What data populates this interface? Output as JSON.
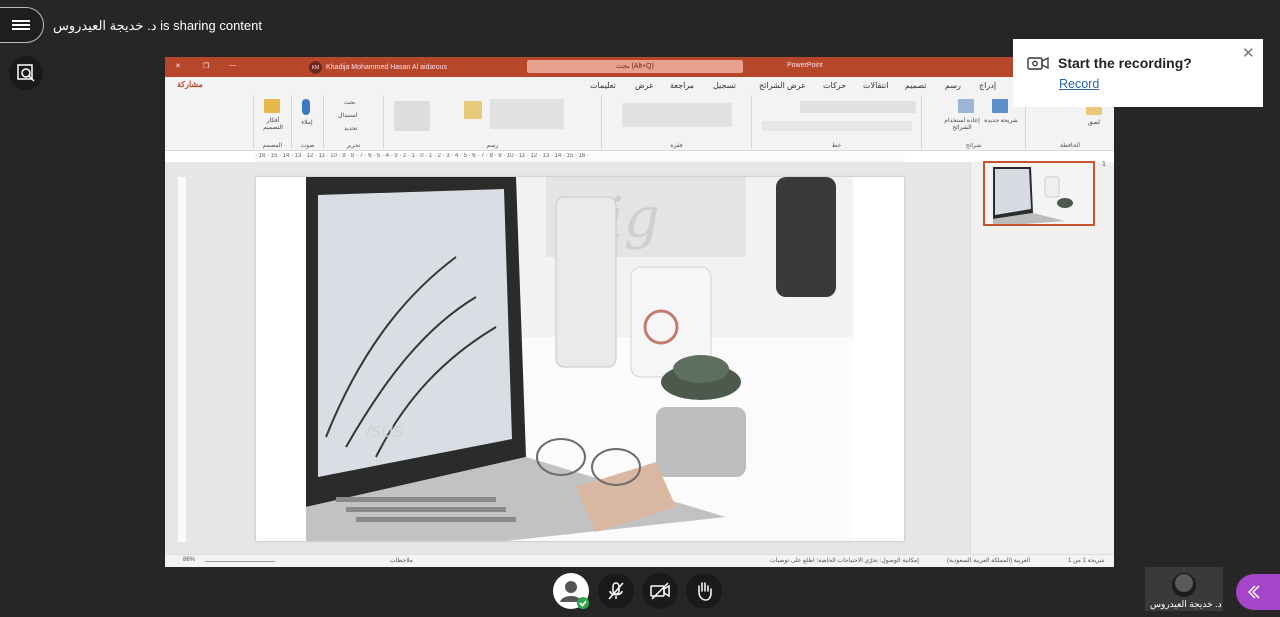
{
  "header": {
    "sharing_text": "د. خديجة العيدروس is sharing content"
  },
  "powerpoint": {
    "user_name": "Khadija Mohammed Hasan Al aidarous",
    "user_initials": "KM",
    "search_placeholder": "بحث (Alt+Q)",
    "app_name": "PowerPoint",
    "share_label": "مشاركة",
    "tabs": [
      "إدراج",
      "رسم",
      "تصميم",
      "انتقالات",
      "حركات",
      "عرض الشرائح",
      "تسجيل",
      "مراجعة",
      "عرض",
      "تعليمات"
    ],
    "groups": [
      "الحافظة",
      "شرائح",
      "خط",
      "فقرة",
      "رسم",
      "تحرير",
      "صوت",
      "المصمم"
    ],
    "ribbon_labels": {
      "new_slide": "شريحة جديدة",
      "reuse": "إعادة استخدام الشرائح",
      "find": "بحث",
      "replace": "استبدال",
      "select": "تحديد",
      "dictate": "إملاء",
      "designer": "أفكار التصميم",
      "paste": "لصق"
    },
    "ruler_text": "· 16 · 15 · 14 · 13 · 12 · 11 · 10 · 9 · 8 · 7 · 6 · 5 · 4 · 3 · 2 · 1 · 0 · 1 · 2 · 3 · 4 · 5 · 6 · 7 · 8 · 9 · 10 · 11 · 12 · 13 · 14 · 15 · 16 ·",
    "slide_number": "1",
    "status": {
      "zoom": "86%",
      "notes": "ملاحظات",
      "language": "العربية (المملكة العربية السعودية)",
      "accessibility": "إمكانية الوصول: تحرّي الاحتياجات الخاصة؛ اطلع على توصيات",
      "slide_of": "شريحة 1 من 1"
    }
  },
  "recording_popup": {
    "title": "Start the recording?",
    "link": "Record"
  },
  "self_view": {
    "name": "د. خديجة العيدروس"
  }
}
